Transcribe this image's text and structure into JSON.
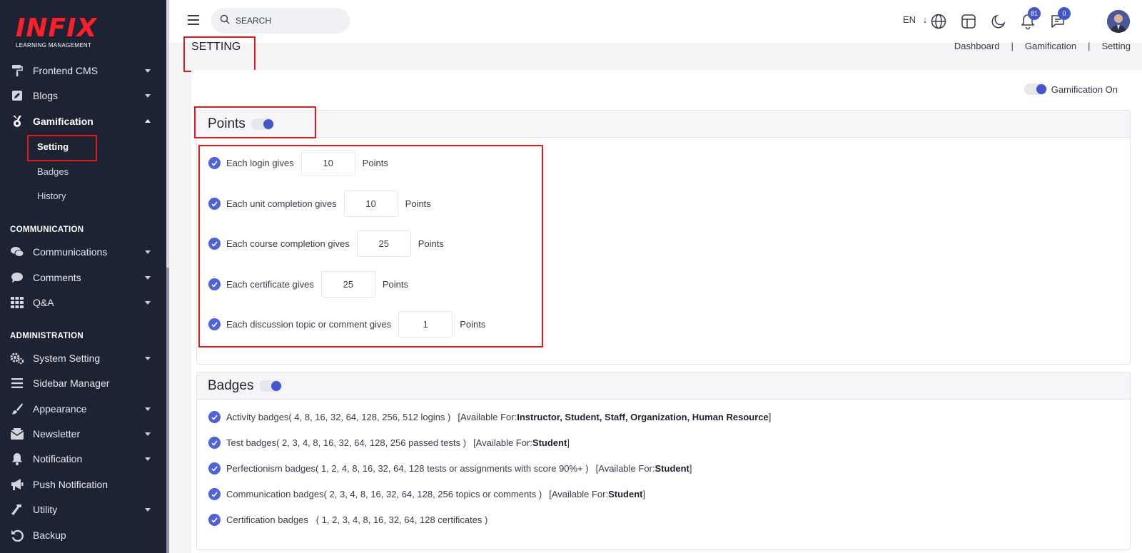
{
  "logo": {
    "main": "INFIX",
    "sub": "LEARNING MANAGEMENT"
  },
  "sidebar": {
    "items": [
      {
        "label": "Frontend CMS",
        "icon": "paint-roller-icon"
      },
      {
        "label": "Blogs",
        "icon": "edit-icon"
      },
      {
        "label": "Gamification",
        "icon": "medal-icon"
      }
    ],
    "gamification_sub": [
      "Setting",
      "Badges",
      "History"
    ],
    "section_communication": "COMMUNICATION",
    "comm_items": [
      {
        "label": "Communications",
        "icon": "comments-icon"
      },
      {
        "label": "Comments",
        "icon": "comment-icon"
      },
      {
        "label": "Q&A",
        "icon": "grid-icon"
      }
    ],
    "section_administration": "ADMINISTRATION",
    "admin_items": [
      {
        "label": "System Setting",
        "icon": "cogs-icon"
      },
      {
        "label": "Sidebar Manager",
        "icon": "bars-icon"
      },
      {
        "label": "Appearance",
        "icon": "brush-icon"
      },
      {
        "label": "Newsletter",
        "icon": "envelope-icon"
      },
      {
        "label": "Notification",
        "icon": "bell-icon"
      },
      {
        "label": "Push Notification",
        "icon": "bullhorn-icon"
      },
      {
        "label": "Utility",
        "icon": "hammer-icon"
      },
      {
        "label": "Backup",
        "icon": "undo-icon"
      }
    ]
  },
  "topbar": {
    "search_placeholder": "SEARCH",
    "lang": "EN",
    "notifications_count": "81",
    "messages_count": "0"
  },
  "page": {
    "title": "SETTING",
    "breadcrumb": [
      "Dashboard",
      "Gamification",
      "Setting"
    ]
  },
  "gamification_toggle": "Gamification On",
  "points": {
    "title": "Points",
    "unit": "Points",
    "rows": [
      {
        "label": "Each login gives",
        "value": "10"
      },
      {
        "label": "Each unit completion gives",
        "value": "10"
      },
      {
        "label": "Each course completion gives",
        "value": "25"
      },
      {
        "label": "Each certificate gives",
        "value": "25"
      },
      {
        "label": "Each discussion topic or comment gives",
        "value": "1"
      }
    ]
  },
  "badges": {
    "title": "Badges",
    "available_prefix": "[Available For: ",
    "available_suffix": " ]",
    "rows": [
      {
        "label": "Activity badges( 4, 8, 16, 32, 64, 128, 256, 512 logins )",
        "available": "Instructor, Student, Staff, Organization, Human Resource"
      },
      {
        "label": "Test badges( 2, 3, 4, 8, 16, 32, 64, 128, 256 passed tests )",
        "available": "Student"
      },
      {
        "label": "Perfectionism badges( 1, 2, 4, 8, 16, 32, 64, 128 tests or assignments with score 90%+ )",
        "available": "Student"
      },
      {
        "label": "Communication badges( 2, 3, 4, 8, 16, 32, 64, 128, 256 topics or comments )",
        "available": "Student"
      },
      {
        "label": "Certification badges   ( 1, 2, 3, 4, 8, 16, 32, 64, 128 certificates )",
        "available": null
      }
    ]
  },
  "colors": {
    "sidebar_bg": "#1e2333",
    "accent": "#4f63d6",
    "highlight_box": "#e31b1b"
  }
}
